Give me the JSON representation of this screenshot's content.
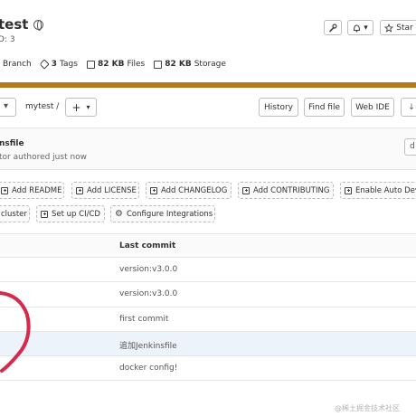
{
  "project": {
    "name": "test",
    "id_text": "D: 3"
  },
  "header_actions": {
    "bell_caret": "▾",
    "star_label": "Star"
  },
  "stats": [
    {
      "value": "",
      "label": "Branch",
      "icon": "branch-icon"
    },
    {
      "value": "3",
      "label": "Tags",
      "icon": "tag-icon"
    },
    {
      "value": "82 KB",
      "label": "Files",
      "icon": "files-icon"
    },
    {
      "value": "82 KB",
      "label": "Storage",
      "icon": "storage-icon"
    }
  ],
  "colors": {
    "banner": "#b37a1d",
    "highlight_row": "#edf3fb",
    "annotation": "#d62a4d"
  },
  "toolbar": {
    "ref_caret": "▾",
    "breadcrumb": "mytest /",
    "add_plus": "+",
    "add_caret": "▾",
    "history": "History",
    "find_file": "Find file",
    "web_ide": "Web IDE",
    "clone_caret": "↓"
  },
  "last_commit": {
    "title": "nsfile",
    "author": "tor",
    "meta": " authored just now",
    "copy_label": "d"
  },
  "shortcuts": {
    "readme": "Add README",
    "license": "Add LICENSE",
    "changelog": "Add CHANGELOG",
    "contributing": "Add CONTRIBUTING",
    "auto_devops": "Enable Auto Dev",
    "cluster": "cluster",
    "cicd": "Set up CI/CD",
    "integrations": "Configure Integrations"
  },
  "file_table": {
    "header_last_commit": "Last commit",
    "rows": [
      {
        "last_commit": "version:v3.0.0"
      },
      {
        "last_commit": "version:v3.0.0"
      },
      {
        "last_commit": "first commit"
      },
      {
        "last_commit": "追加Jenkinsfile"
      },
      {
        "last_commit": "docker config!"
      }
    ]
  },
  "watermark": "@稀土掘金技术社区"
}
